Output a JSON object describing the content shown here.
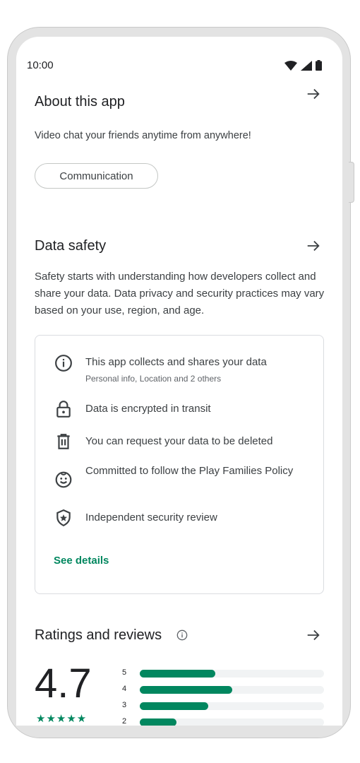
{
  "status_bar": {
    "time": "10:00",
    "icons": [
      "wifi-icon",
      "signal-icon",
      "battery-icon"
    ]
  },
  "about": {
    "title": "About this app",
    "description": "Video chat your friends anytime from anywhere!",
    "category_chip": "Communication"
  },
  "data_safety": {
    "title": "Data safety",
    "description": "Safety starts with understanding how developers collect and share your data. Data privacy and security practices may vary based on your use, region, and age.",
    "items": [
      {
        "icon": "info-icon",
        "text": "This app collects and shares your data",
        "subtext": "Personal info, Location and 2 others"
      },
      {
        "icon": "lock-icon",
        "text": "Data is encrypted in transit"
      },
      {
        "icon": "trash-icon",
        "text": "You can request your data to be deleted"
      },
      {
        "icon": "families-icon",
        "text": "Committed to follow the Play Families Policy"
      },
      {
        "icon": "shield-star-icon",
        "text": "Independent security review"
      }
    ],
    "see_details": "See details"
  },
  "ratings": {
    "title": "Ratings and reviews",
    "average": "4.7",
    "stars": "★★★★★",
    "distribution": [
      {
        "stars": "5",
        "fraction": 0.41
      },
      {
        "stars": "4",
        "fraction": 0.5
      },
      {
        "stars": "3",
        "fraction": 0.37
      },
      {
        "stars": "2",
        "fraction": 0.2
      }
    ]
  },
  "colors": {
    "accent": "#01875f",
    "text": "#202124",
    "secondary": "#3c4043"
  }
}
